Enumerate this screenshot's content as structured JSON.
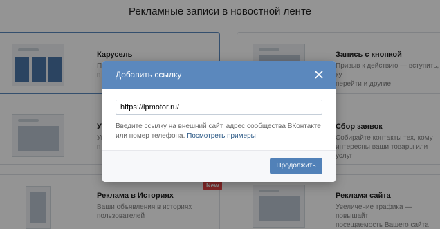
{
  "page": {
    "title": "Рекламные записи в новостной ленте"
  },
  "cards": [
    {
      "title": "Карусель",
      "desc_1": "П",
      "desc_2": "п"
    },
    {
      "title": "Запись с кнопкой",
      "desc_1": "Призыв к действию — вступить, ку",
      "desc_2": "перейти и другие"
    },
    {
      "title": "Ун",
      "desc_1": "Ув",
      "desc_2": "п"
    },
    {
      "title": "Сбор заявок",
      "desc_1": "Собирайте контакты тех, кому",
      "desc_2": "интересны ваши товары или услуг"
    },
    {
      "title": "Реклама в Историях",
      "desc_1": "Ваши объявления в историях",
      "desc_2": "пользователей",
      "badge": "New"
    },
    {
      "title": "Реклама сайта",
      "desc_1": "Увеличение трафика — повышайт",
      "desc_2": "посещаемость Вашего сайта"
    }
  ],
  "modal": {
    "title": "Добавить ссылку",
    "input_value": "https://lpmotor.ru/",
    "hint_text": "Введите ссылку на внешний сайт, адрес сообщества ВКонтакте или номер телефона.",
    "hint_link": "Посмотреть примеры",
    "continue_label": "Продолжить"
  }
}
